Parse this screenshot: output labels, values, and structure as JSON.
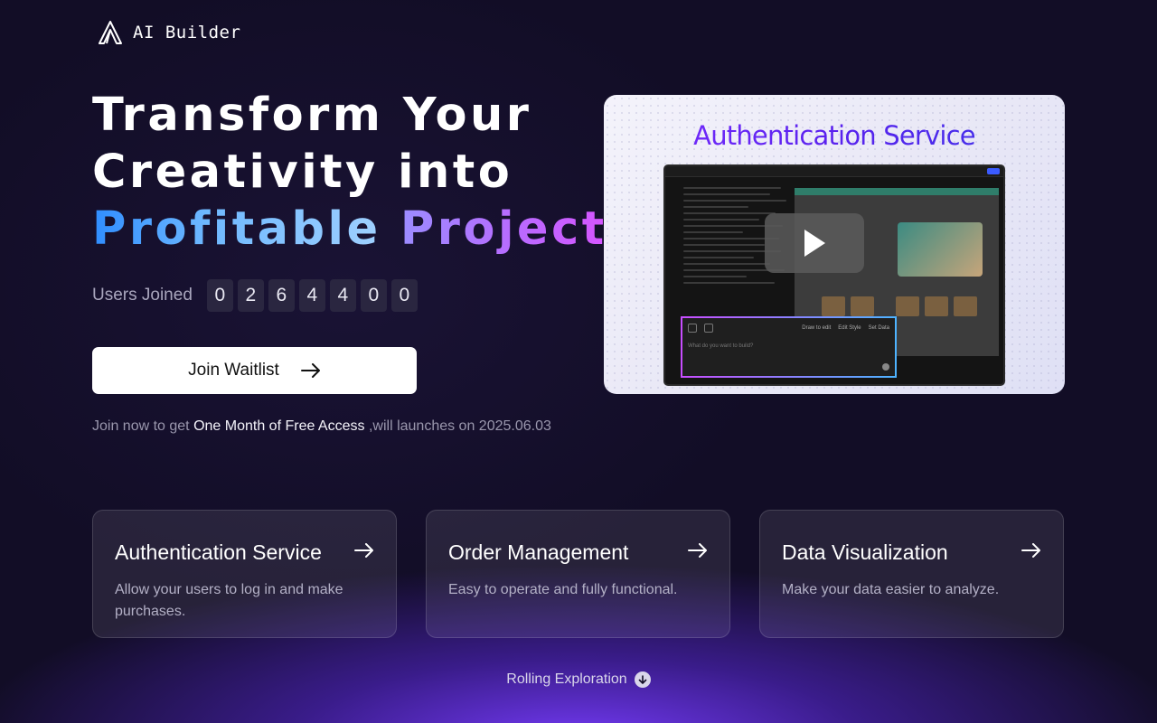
{
  "brand": {
    "name": "AI Builder",
    "logo_icon": "a-triangle-logo-icon"
  },
  "hero": {
    "line1": "Transform Your",
    "line2": "Creativity into",
    "line3_part1": "Profitable",
    "line3_part2": "Projects",
    "gradient_colors": [
      "#2f8dff",
      "#9fd0ff",
      "#9b8cff",
      "#e04dff"
    ]
  },
  "users": {
    "label": "Users Joined",
    "digits": [
      "0",
      "2",
      "6",
      "4",
      "4",
      "0",
      "0"
    ]
  },
  "cta": {
    "label": "Join Waitlist",
    "icon": "arrow-right-icon"
  },
  "note": {
    "prefix": "Join now to get",
    "highlight": "One Month of Free Access",
    "suffix": ",will launches on 2025.06.03"
  },
  "video": {
    "title": "Authentication Service",
    "play_icon": "play-icon",
    "prompt_placeholder": "What do you want to build?",
    "tool_labels": [
      "Draw to edit",
      "Edit Style",
      "Set Data"
    ]
  },
  "cards": [
    {
      "title": "Authentication Service",
      "desc": "Allow your users to log in and make purchases."
    },
    {
      "title": "Order Management",
      "desc": "Easy to operate and fully functional."
    },
    {
      "title": "Data Visualization",
      "desc": "Make your data easier to analyze."
    }
  ],
  "scroll": {
    "label": "Rolling Exploration",
    "icon": "arrow-down-circle-icon"
  },
  "colors": {
    "background": "#120d26",
    "accent_glow": "#7a3cff",
    "card_bg": "#ffffff17"
  }
}
